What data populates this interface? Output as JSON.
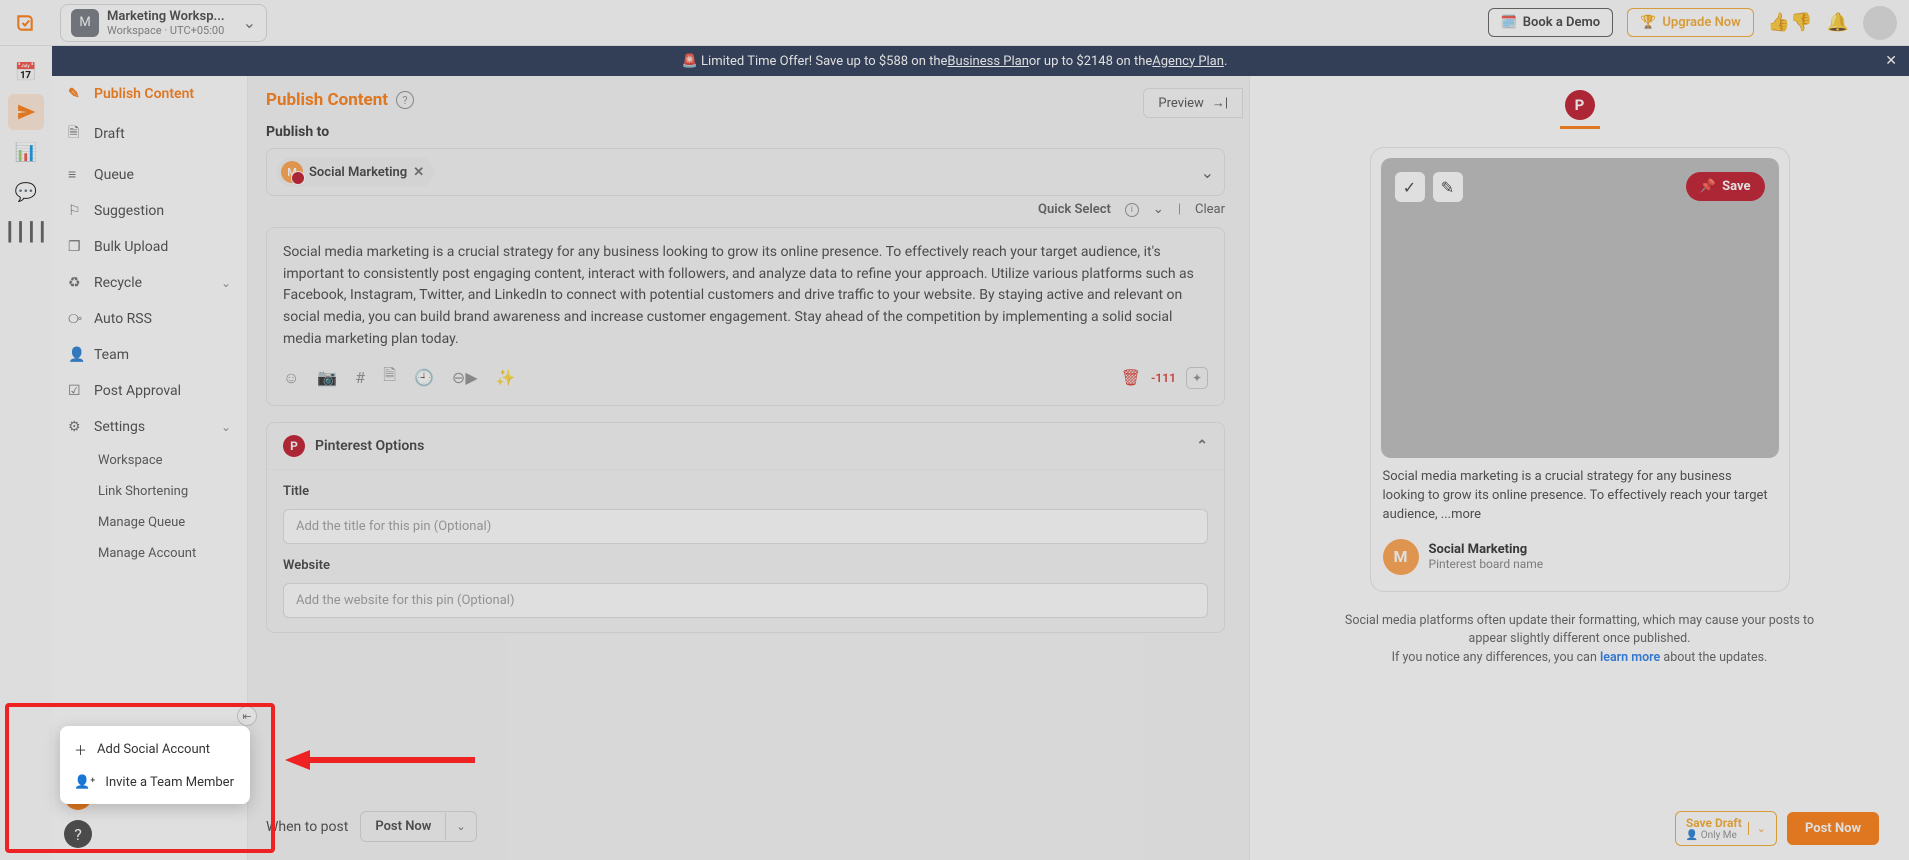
{
  "topbar": {
    "workspace": {
      "avatar": "M",
      "name": "Marketing Worksp...",
      "sub": "Workspace · UTC+05:00"
    },
    "book_demo": "Book a Demo",
    "upgrade": "Upgrade Now"
  },
  "banner": {
    "prefix": "🚨 Limited Time Offer! Save up to $588 on the ",
    "plan1": "Business Plan",
    "mid": " or up to $2148 on the ",
    "plan2": "Agency Plan",
    "suffix": "."
  },
  "sidebar": {
    "items": {
      "publish": "Publish Content",
      "draft": "Draft",
      "queue": "Queue",
      "suggestion": "Suggestion",
      "bulk": "Bulk Upload",
      "recycle": "Recycle",
      "autorss": "Auto RSS",
      "team": "Team",
      "approval": "Post Approval",
      "settings": "Settings"
    },
    "settings_sub": {
      "workspace": "Workspace",
      "link": "Link Shortening",
      "queue": "Manage Queue",
      "account": "Manage Account"
    }
  },
  "editor": {
    "title": "Publish Content",
    "preview_toggle": "Preview",
    "publish_to_label": "Publish to",
    "account": "Social Marketing",
    "quick_select": "Quick Select",
    "clear": "Clear",
    "body": "Social media marketing is a crucial strategy for any business looking to grow its online presence. To effectively reach your target audience, it's important to consistently post engaging content, interact with followers, and analyze data to refine your approach. Utilize various platforms such as Facebook, Instagram, Twitter, and LinkedIn to connect with potential customers and drive traffic to your website. By staying active and relevant on social media, you can build brand awareness and increase customer engagement. Stay ahead of the competition by implementing a solid social media marketing plan today.",
    "char_count": "-111",
    "pin_options": {
      "header": "Pinterest Options",
      "title_label": "Title",
      "title_placeholder": "Add the title for this pin (Optional)",
      "website_label": "Website",
      "website_placeholder": "Add the website for this pin (Optional)"
    },
    "when_to_post_label": "When to post",
    "when_to_post_value": "Post Now"
  },
  "preview": {
    "save": "Save",
    "desc": "Social media marketing is a crucial strategy for any business looking to grow its online presence. To effectively reach your target audience, ...more",
    "user_name": "Social Marketing",
    "user_sub": "Pinterest board name",
    "note1": "Social media platforms often update their formatting, which may cause your posts to appear slightly different once published.",
    "note2a": "If you notice any differences, you can ",
    "note2link": "learn more",
    "note2b": " about the updates.",
    "save_draft": "Save Draft",
    "only_me": "Only Me",
    "post_now": "Post Now"
  },
  "popup": {
    "add_social": "Add Social Account",
    "invite": "Invite a Team Member"
  }
}
